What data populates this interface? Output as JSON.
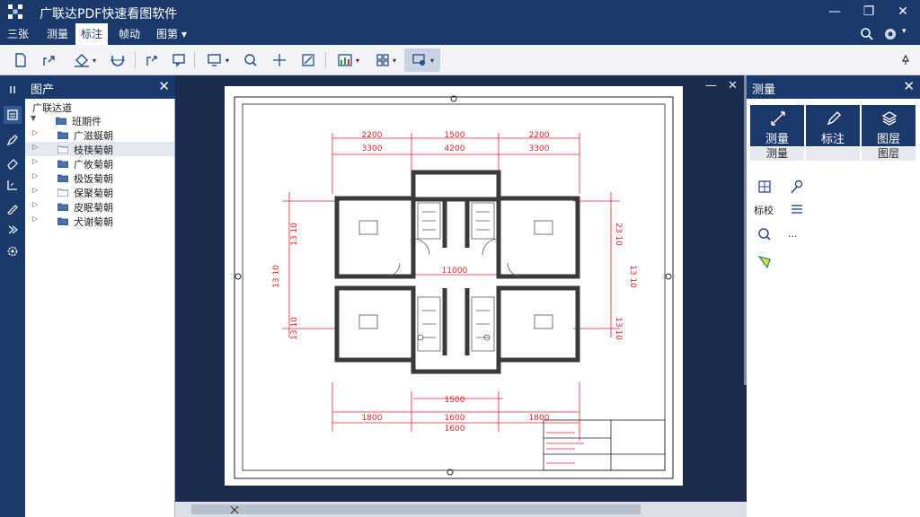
{
  "window": {
    "title": "广联达PDF快速看图软件",
    "minimize": "—",
    "restore": "❐",
    "close": "✕"
  },
  "menu": {
    "items": [
      {
        "label": "三张"
      },
      {
        "label": "测量"
      },
      {
        "label": "标注"
      },
      {
        "label": "帧动"
      },
      {
        "label": "图第"
      }
    ],
    "active_index": 2,
    "dropdown_caret": "▾"
  },
  "left_panel": {
    "title": "图产",
    "close": "✕",
    "root": "广联达道",
    "items": [
      {
        "label": "班期件",
        "expanded": true,
        "level": 0
      },
      {
        "label": "广滋蜒朝",
        "level": 1
      },
      {
        "label": "枝筷菊朝",
        "level": 1,
        "selected": true
      },
      {
        "label": "广攸菊朝",
        "level": 1
      },
      {
        "label": "极饭菊朝",
        "level": 1
      },
      {
        "label": "保聚菊朝",
        "level": 1
      },
      {
        "label": "皮眠菊朝",
        "level": 1
      },
      {
        "label": "犬谢菊朝",
        "level": 1
      }
    ]
  },
  "canvas": {
    "minimize": "—",
    "close": "✕"
  },
  "drawing": {
    "top_dims_row1": [
      "2200",
      "1500",
      "2200"
    ],
    "top_dims_row2": [
      "3300",
      "4200",
      "3300"
    ],
    "middle_dim": "11000",
    "left_dims": [
      "13 10",
      "13 10",
      "13 10"
    ],
    "right_dims": [
      "23 10",
      "13 10",
      "13 10"
    ],
    "bottom_dims_row1": [
      "1500"
    ],
    "bottom_dims_row2": [
      "1800",
      "1600",
      "1800"
    ],
    "bottom_total": "1600"
  },
  "right_panel": {
    "title": "测量",
    "close": "✕",
    "tabs": [
      {
        "label": "测量",
        "sub": "测量",
        "icon": "measure-icon"
      },
      {
        "label": "标注",
        "sub": "",
        "icon": "pen-icon"
      },
      {
        "label": "图层",
        "sub": "图层",
        "icon": "layers-icon"
      }
    ],
    "tool_labels": [
      "标校",
      "..."
    ]
  },
  "colors": {
    "accent": "#1a3a6b",
    "dim_red": "#e0242b",
    "wall": "#3a3a3a"
  }
}
